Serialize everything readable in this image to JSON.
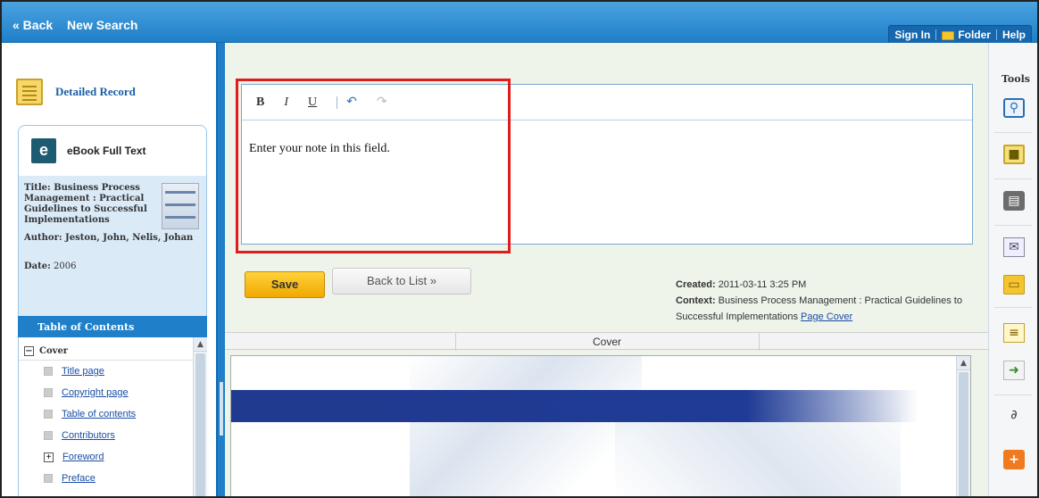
{
  "topbar": {
    "back_label": "« Back",
    "new_search_label": "New Search",
    "sign_in_label": "Sign In",
    "folder_label": "Folder",
    "help_label": "Help"
  },
  "sidebar": {
    "detailed_record_label": "Detailed Record",
    "ebook_label": "eBook Full Text",
    "title_label": "Title:",
    "title_value": "Business Process Management : Practical Guidelines to Successful Implementations",
    "author_label": "Author:",
    "author_value": "Jeston, John, Nelis, Johan",
    "date_label": "Date:",
    "date_value": "2006",
    "toc_header": "Table of Contents",
    "toc_cover": "Cover",
    "toc_items": [
      "Title page",
      "Copyright page",
      "Table of contents",
      "Contributors",
      "Foreword",
      "Preface"
    ]
  },
  "editor": {
    "bold": "B",
    "italic": "I",
    "underline": "U",
    "undo": "↶",
    "redo": "↷",
    "placeholder_text": "Enter your note in this field."
  },
  "actions": {
    "save_label": "Save",
    "back_to_list_label": "Back to List »"
  },
  "meta": {
    "created_label": "Created:",
    "created_value": "2011-03-11 3:25 PM",
    "context_label": "Context:",
    "context_value": "Business Process Management : Practical Guidelines to Successful Implementations",
    "page_cover_link": "Page Cover"
  },
  "viewer": {
    "cover_tab": "Cover"
  },
  "tools": {
    "title": "Tools",
    "icons": [
      "magnifier-icon",
      "note-icon",
      "print-icon",
      "email-icon",
      "folder-icon",
      "document-icon",
      "export-icon",
      "permalink-icon",
      "add-icon"
    ]
  },
  "colors": {
    "topbar_blue": "#1f7fc8",
    "highlight_red": "#e01c1c",
    "save_yellow": "#f0a800"
  }
}
